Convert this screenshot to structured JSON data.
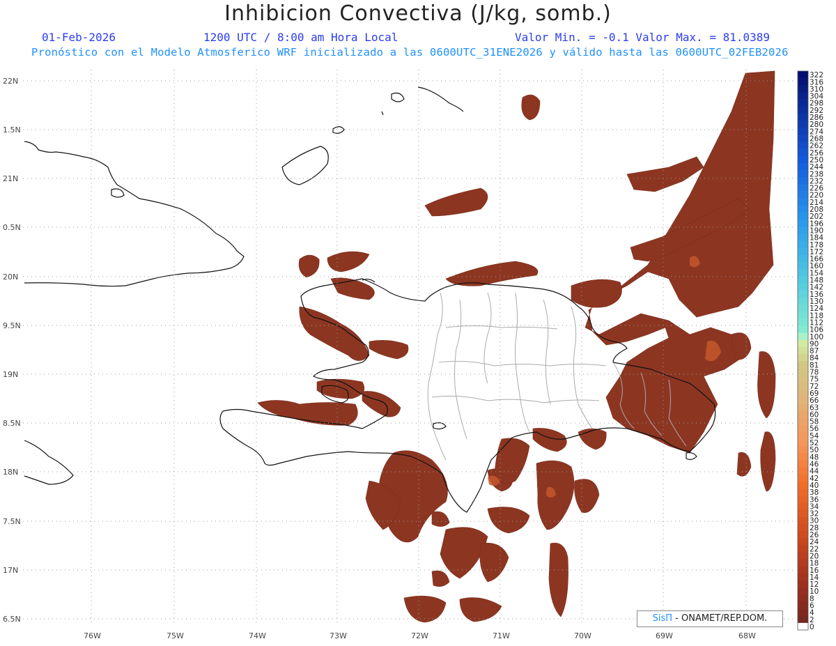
{
  "header": {
    "title": "Inhibicion Convectiva (J/kg, somb.)",
    "date": "01-Feb-2026",
    "time": "1200 UTC / 8:00 am Hora Local",
    "minmax": "Valor Min. = -0.1  Valor Max. = 81.0389",
    "subtitle": "Pronóstico con el Modelo Atmosferico WRF inicializado a las 0600UTC_31ENE2026 y válido hasta las  0600UTC_02FEB2026"
  },
  "axes": {
    "lat_labels": [
      "22N",
      "1.5N",
      "21N",
      "0.5N",
      "20N",
      "9.5N",
      "19N",
      "8.5N",
      "18N",
      "7.5N",
      "17N",
      "6.5N"
    ],
    "lon_labels": [
      "76W",
      "75W",
      "74W",
      "73W",
      "72W",
      "71W",
      "70W",
      "69W",
      "68W"
    ]
  },
  "colorbar": {
    "labels": [
      "322",
      "316",
      "310",
      "304",
      "298",
      "292",
      "286",
      "280",
      "274",
      "268",
      "262",
      "256",
      "250",
      "244",
      "238",
      "232",
      "226",
      "220",
      "214",
      "208",
      "202",
      "196",
      "190",
      "184",
      "178",
      "172",
      "166",
      "160",
      "154",
      "148",
      "142",
      "136",
      "130",
      "124",
      "118",
      "112",
      "106",
      "100",
      "90",
      "87",
      "84",
      "81",
      "78",
      "75",
      "72",
      "69",
      "66",
      "63",
      "60",
      "58",
      "56",
      "54",
      "52",
      "50",
      "48",
      "46",
      "44",
      "42",
      "40",
      "38",
      "36",
      "34",
      "32",
      "30",
      "28",
      "26",
      "24",
      "22",
      "20",
      "18",
      "16",
      "14",
      "12",
      "10",
      "8",
      "6",
      "4",
      "2",
      "0"
    ]
  },
  "credit": {
    "brand": "SisΠ",
    "text": " - ONAMET/REP.DOM."
  },
  "colors": {
    "field": "#8c3622",
    "field_edge": "#a03a1f",
    "coast": "#111111",
    "provinces": "#aaaaaa",
    "grid": "#9a9a9a"
  }
}
